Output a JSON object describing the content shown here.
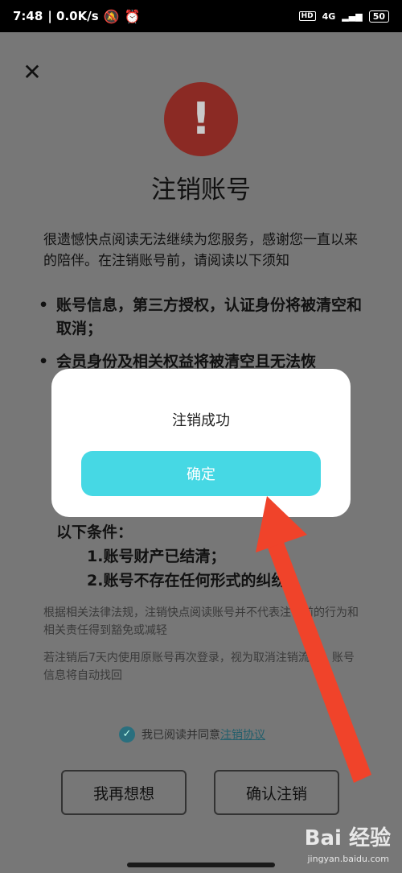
{
  "status_bar": {
    "time": "7:48",
    "speed": "| 0.0K/s",
    "network": "4G",
    "battery": "50"
  },
  "header": {
    "title": "注销账号"
  },
  "intro": "很遗憾快点阅读无法继续为您服务，感谢您一直以来的陪伴。在注销账号前，请阅读以下须知",
  "notices": [
    "账号信息，第三方授权，认证身份将被清空和取消；",
    "会员身份及相关权益将被清空且无法恢",
    "",
    "",
    ""
  ],
  "conditions": {
    "heading": "以下条件：",
    "items": [
      "1.账号财产已结清；",
      "2.账号不存在任何形式的纠纷。"
    ]
  },
  "legal": [
    "根据相关法律法规，注销快点阅读账号并不代表注销前的行为和相关责任得到豁免或减轻",
    "若注销后7天内使用原账号再次登录，视为取消注销流程，账号信息将自动找回"
  ],
  "agreement": {
    "text": "我已阅读并同意",
    "link": "注销协议"
  },
  "buttons": {
    "reconsider": "我再想想",
    "confirm_cancel": "确认注销"
  },
  "dialog": {
    "message": "注销成功",
    "confirm": "确定"
  },
  "watermark": {
    "brand": "Bai 经验",
    "url": "jingyan.baidu.com"
  },
  "colors": {
    "dialog_button": "#46d8e4",
    "warn_circle": "#8b2a24",
    "arrow": "#f0432a"
  },
  "icons": {
    "close": "close-icon",
    "warning": "exclamation-icon",
    "check": "check-circle-icon"
  }
}
